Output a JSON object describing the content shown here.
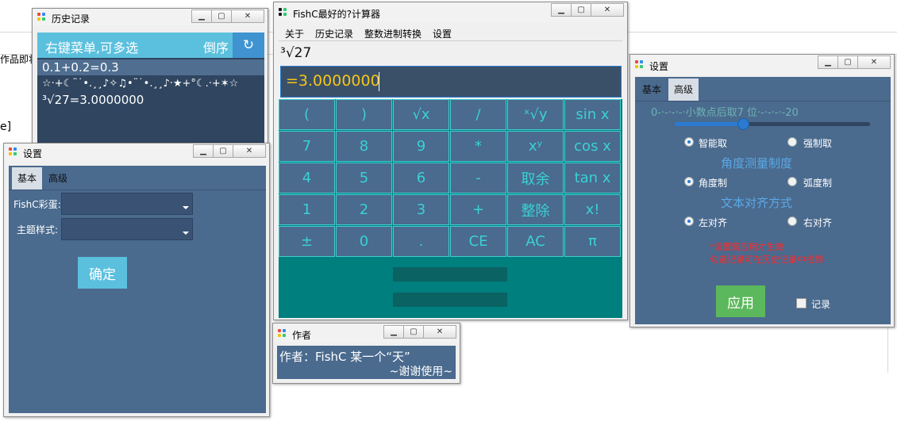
{
  "background": {
    "lines": [
      "作品即将",
      "e]"
    ]
  },
  "history_window": {
    "title": "历史记录",
    "header_text": "右键菜单,可多选",
    "reverse_label": "倒序",
    "refresh_icon": "refresh-icon",
    "items": [
      "0.1+0.2=0.3",
      "☆·+☾¨˙•.¸¸♪✧♫•¨˙•.¸¸♪·★+°☾.·+✶☆",
      "³√27=3.0000000"
    ]
  },
  "settings_small": {
    "title": "设置",
    "tabs": [
      "基本",
      "高级"
    ],
    "egg_label": "FishC彩蛋:",
    "theme_label": "主题样式:",
    "confirm_label": "确定"
  },
  "calculator": {
    "title": "FishC最好的?计算器",
    "menu": [
      "关于",
      "历史记录",
      "整数进制转换",
      "设置"
    ],
    "expression": "³√27",
    "result": "=3.0000000",
    "buttons": [
      [
        "(",
        ")",
        "√x",
        "/",
        "ˣ√y",
        "sin x"
      ],
      [
        "7",
        "8",
        "9",
        "*",
        "xʸ",
        "cos x"
      ],
      [
        "4",
        "5",
        "6",
        "-",
        "取余",
        "tan x"
      ],
      [
        "1",
        "2",
        "3",
        "+",
        "整除",
        "x!"
      ],
      [
        "±",
        "0",
        ".",
        "CE",
        "AC",
        "π"
      ]
    ]
  },
  "author_window": {
    "title": "作者",
    "line1": "作者：FishC 某一个“天”",
    "line2": "~谢谢使用~"
  },
  "settings_large": {
    "title": "设置",
    "tabs": [
      "基本",
      "高级"
    ],
    "slider_left": "0-·-·-·-·",
    "slider_mid": "小数点后取7 位",
    "slider_right": "·-·-·-·-20",
    "slider_value": 7,
    "slider_min": 0,
    "slider_max": 20,
    "round_options": [
      "智能取",
      "强制取"
    ],
    "angle_title": "角度测量制度",
    "angle_options": [
      "角度制",
      "弧度制"
    ],
    "align_title": "文本对齐方式",
    "align_options": [
      "左对齐",
      "右对齐"
    ],
    "note_line1": "*设置需应用才生效",
    "note_line2": "勾选记录可在历史记录中找到",
    "apply_label": "应用",
    "record_label": "记录",
    "colors": {
      "slider_text": "#6fb3b3",
      "note": "#ff2a2a",
      "apply_bg": "#5cb85c",
      "section_title": "#5aa9e6"
    }
  },
  "common": {
    "minimize_icon": "minimize-icon",
    "maximize_icon": "maximize-icon",
    "close_icon": "close-icon",
    "app_icon": "fishc-app-icon",
    "accent": "#5bc0de",
    "calc_button_color": "#39d2d2",
    "teal": "#008080"
  }
}
